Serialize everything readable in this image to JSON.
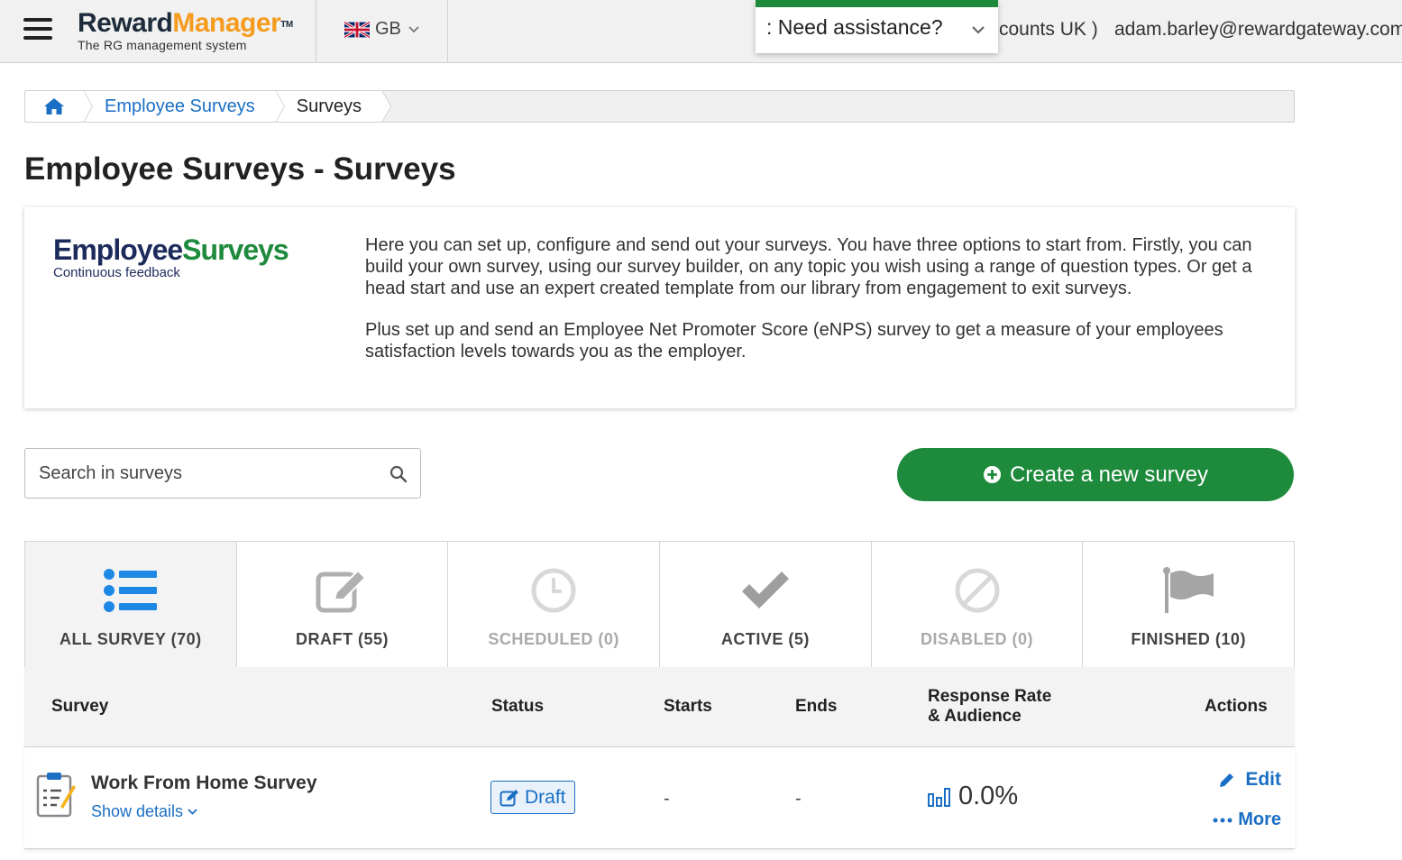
{
  "header": {
    "brand_main_a": "Reward",
    "brand_main_b": "Manager",
    "brand_tm": "TM",
    "brand_sub": "The RG management system",
    "locale": "GB",
    "assist_label": ": Need assistance?",
    "account_fragment": "counts UK )",
    "email": "adam.barley@rewardgateway.com"
  },
  "breadcrumb": {
    "items": [
      "Employee Surveys",
      "Surveys"
    ]
  },
  "page": {
    "title": "Employee Surveys - Surveys"
  },
  "intro": {
    "logo_a": "Employ",
    "logo_b": "ee",
    "logo_c": "Surveys",
    "logo_sub": "Continuous feedback",
    "paragraph_1": "Here you can set up, configure and send out your surveys. You have three options to start from. Firstly, you can build your own survey, using our survey builder, on any topic you wish using a range of question types. Or get a head start and use an expert created template from our library from engagement to exit surveys.",
    "paragraph_2": "Plus set up and send an Employee Net Promoter Score (eNPS) survey to get a measure of your employees satisfaction levels towards you as the employer."
  },
  "search": {
    "placeholder": "Search in surveys"
  },
  "create_button": {
    "label": "Create a new survey"
  },
  "tabs": [
    {
      "label": "ALL SURVEY (70)"
    },
    {
      "label": "DRAFT (55)"
    },
    {
      "label": "SCHEDULED (0)"
    },
    {
      "label": "ACTIVE (5)"
    },
    {
      "label": "DISABLED (0)"
    },
    {
      "label": "FINISHED (10)"
    }
  ],
  "table": {
    "columns": {
      "survey": "Survey",
      "status": "Status",
      "starts": "Starts",
      "ends": "Ends",
      "rate_1": "Response Rate",
      "rate_2": "& Audience",
      "actions": "Actions"
    },
    "rows": [
      {
        "name": "Work From Home Survey",
        "details": "Show details",
        "status": "Draft",
        "starts": "-",
        "ends": "-",
        "rate": "0.0%",
        "edit": "Edit",
        "more": "More"
      }
    ]
  },
  "colors": {
    "brand_green": "#1e8a3c",
    "link_blue": "#1a6fc4",
    "brand_orange": "#f59b1d",
    "navy": "#1d2b3a"
  }
}
